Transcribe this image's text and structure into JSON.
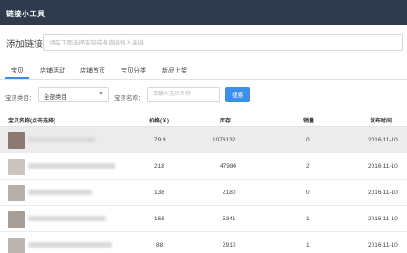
{
  "app": {
    "title": "链接小工具"
  },
  "link_bar": {
    "label": "添加链接",
    "placeholder": "请在下面选择店铺或者直接输入连接"
  },
  "tabs": [
    {
      "label": "宝贝",
      "active": true
    },
    {
      "label": "店铺活动",
      "active": false
    },
    {
      "label": "店铺首页",
      "active": false
    },
    {
      "label": "宝贝分类",
      "active": false
    },
    {
      "label": "新品上架",
      "active": false
    }
  ],
  "filters": {
    "category_label": "宝贝类目：",
    "category_value": "全部类目",
    "name_label": "宝贝名称：",
    "name_placeholder": "请输入宝贝名称",
    "search_button": "搜索"
  },
  "table": {
    "headers": {
      "name": "宝贝名称(点击选择)",
      "price": "价格(￥)",
      "stock": "库存",
      "sales": "销量",
      "published": "发布时间"
    },
    "rows": [
      {
        "price": "79.9",
        "stock": "1076132",
        "sales": "0",
        "published": "2016-11-10",
        "highlighted": true,
        "thumb_color": "#8c7a72"
      },
      {
        "price": "218",
        "stock": "47984",
        "sales": "2",
        "published": "2016-11-10",
        "highlighted": false,
        "thumb_color": "#c9c4c0"
      },
      {
        "price": "138",
        "stock": "2180",
        "sales": "0",
        "published": "2016-11-10",
        "highlighted": false,
        "thumb_color": "#b7b0aa"
      },
      {
        "price": "168",
        "stock": "5341",
        "sales": "1",
        "published": "2016-11-10",
        "highlighted": false,
        "thumb_color": "#a69d97"
      },
      {
        "price": "88",
        "stock": "2910",
        "sales": "1",
        "published": "2016-11-10",
        "highlighted": false,
        "thumb_color": "#bdb5ae"
      }
    ]
  },
  "colors": {
    "titlebar": "#2f3a4d",
    "accent": "#3d8ee8",
    "highlight_row": "#ececec"
  }
}
